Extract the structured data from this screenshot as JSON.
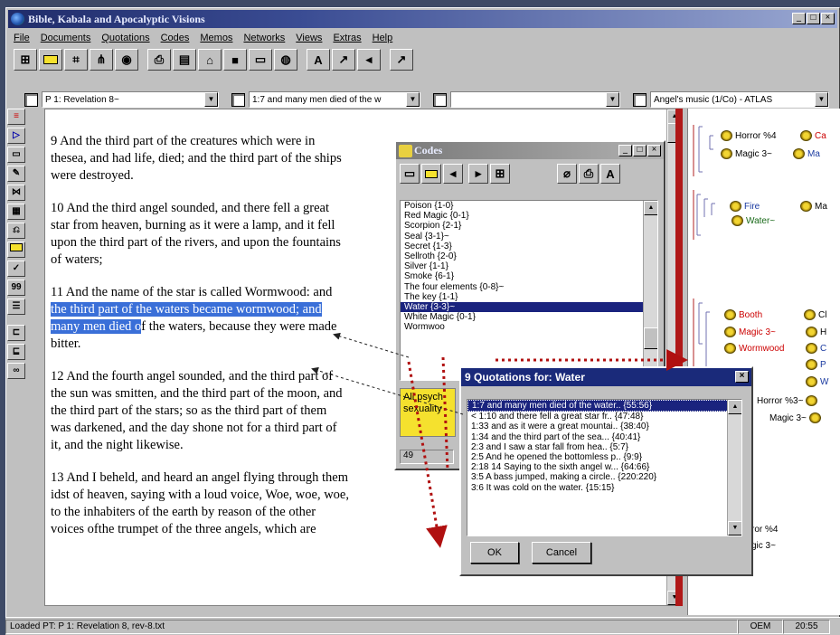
{
  "window": {
    "title": "Bible, Kabala and Apocalyptic Visions"
  },
  "menu": [
    "File",
    "Documents",
    "Quotations",
    "Codes",
    "Memos",
    "Networks",
    "Views",
    "Extras",
    "Help"
  ],
  "combos": {
    "document": "P 1: Revelation 8~",
    "quotation": "1:7 and many men died of the w",
    "code": "",
    "network": "Angel's music (1/Co) - ATLAS"
  },
  "doc_paragraphs": [
    {
      "id": "p9",
      "text": "9  And the third part of the creatures which were in thesea, and had life, died; and the third part of the ships were destroyed."
    },
    {
      "id": "p10",
      "text": "10  And the third angel sounded, and there fell a great star from heaven, burning as it were a lamp, and it fell upon the third part of the rivers, and upon the fountains of waters;"
    },
    {
      "id": "p11",
      "before": "11  And the name of the star is called Wormwood: and ",
      "hl": "the third part of the waters became wormwood; and many men died o",
      "after": "f the waters, because they were made bitter."
    },
    {
      "id": "p12",
      "text": "12  And the fourth angel sounded, and the third part of the sun was smitten, and the third part of the moon, and the third part of the stars; so as the third part of them was darkened, and the day shone not for a third part of it, and the night likewise."
    },
    {
      "id": "p13",
      "text": "13  And I beheld, and heard an angel flying through them idst of heaven, saying with a loud voice, Woe, woe, woe, to the inhabiters of the earth by reason of the other voices ofthe trumpet of the three angels, which are"
    }
  ],
  "codes_window": {
    "title": "Codes",
    "items": [
      "Poison {1-0}",
      "Red Magic {0-1}",
      "Scorpion {2-1}",
      "Seal {3-1}~",
      "Secret {1-3}",
      "Sellroth {2-0}",
      "Silver {1-1}",
      "Smoke {6-1}",
      "The four elements {0-8}~",
      "The key {1-1}",
      "Water {3-3}~",
      "White Magic {0-1}",
      "Wormwoo"
    ],
    "selected": "Water {3-3}~",
    "memo_text": "All psych sexuality",
    "count": "49"
  },
  "quotations_dialog": {
    "title": "9 Quotations for: Water",
    "items": [
      "1:7 and many men died of the water..  {55:56}",
      "< 1:10 and there fell a great star fr..  {47:48}",
      "1:33 and as it were a great mountai..  {38:40}",
      "1:34 and the third part of the sea...  {40:41}",
      "2:3 and I saw a star fall from hea..  {5:7}",
      "2:5 And he opened the bottomless p..  {9:9}",
      "2:18 14 Saying to the sixth angel w...  {64:66}",
      "3:5 A bass jumped, making a circle..  {220:220}",
      "3:6 It was cold on the water.  {15:15}"
    ],
    "ok": "OK",
    "cancel": "Cancel"
  },
  "network_nodes": [
    {
      "label": "Horror %4",
      "color": "#000000"
    },
    {
      "label": "Ca",
      "color": "#cc0000"
    },
    {
      "label": "Magic 3~",
      "color": "#000000"
    },
    {
      "label": "Ma",
      "color": "#1a3aa0"
    },
    {
      "label": "Fire",
      "color": "#1a3aa0"
    },
    {
      "label": "Ma",
      "color": "#000000"
    },
    {
      "label": "Water~",
      "color": "#1a6a1a"
    },
    {
      "label": "Booth",
      "color": "#cc0000"
    },
    {
      "label": "Cl",
      "color": "#000000"
    },
    {
      "label": "Magic 3~",
      "color": "#cc0000"
    },
    {
      "label": "H",
      "color": "#000000"
    },
    {
      "label": "Wormwood",
      "color": "#cc0000"
    },
    {
      "label": "C",
      "color": "#1a3aa0"
    },
    {
      "label": "P",
      "color": "#1a3aa0"
    },
    {
      "label": "W",
      "color": "#1a3aa0"
    },
    {
      "label": "Horror %3~",
      "color": "#000000"
    },
    {
      "label": "Magic 3~",
      "color": "#000000"
    },
    {
      "label": "ror %4",
      "color": "#000000"
    },
    {
      "label": "gic 3~",
      "color": "#000000"
    }
  ],
  "status": {
    "text": "Loaded PT: P 1: Revelation 8, rev-8.txt",
    "mode": "OEM",
    "time": "20:55"
  }
}
